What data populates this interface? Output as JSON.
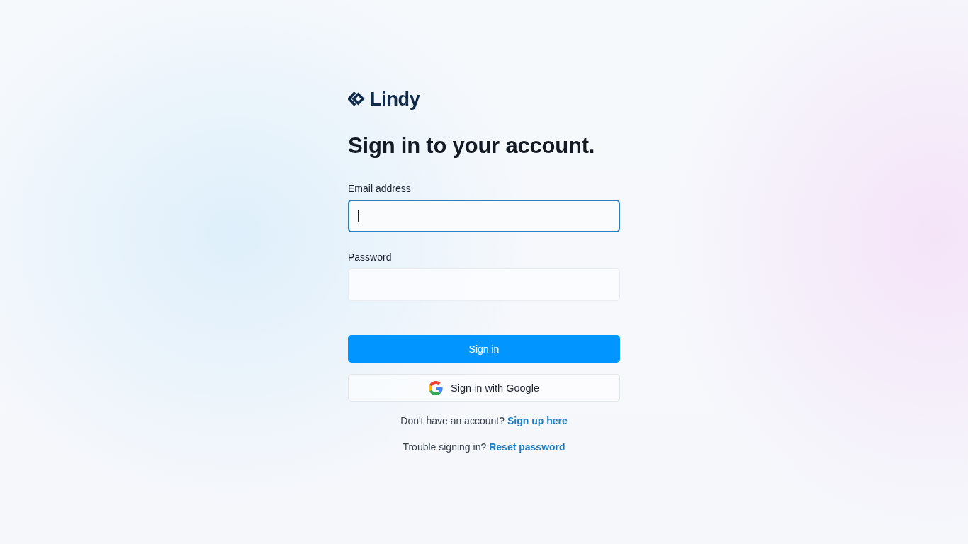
{
  "logo": {
    "name": "Lindy"
  },
  "heading": "Sign in to your account.",
  "fields": [
    {
      "label": "Email address",
      "focused": true
    },
    {
      "label": "Password",
      "focused": false
    }
  ],
  "buttons": [
    {
      "kind": "primary",
      "label": "Sign in"
    },
    {
      "kind": "google",
      "label": "Sign in with Google"
    }
  ],
  "footer_links": [
    {
      "prompt": "Don't have an account?",
      "link": "Sign up here"
    },
    {
      "prompt": "Trouble signing in?",
      "link": "Reset password"
    }
  ]
}
